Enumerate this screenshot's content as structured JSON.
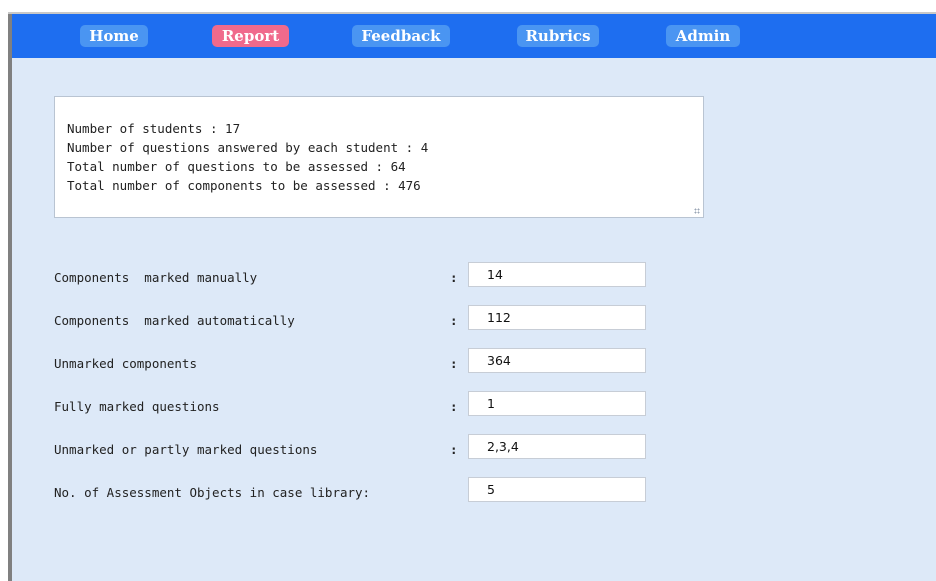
{
  "nav": {
    "items": [
      {
        "label": "Home",
        "active": false
      },
      {
        "label": "Report",
        "active": true
      },
      {
        "label": "Feedback",
        "active": false
      },
      {
        "label": "Rubrics",
        "active": false
      },
      {
        "label": "Admin",
        "active": false
      }
    ],
    "colors": {
      "bar": "#1e6ef0",
      "button": "#4a95f2",
      "active_button": "#f06a8c"
    }
  },
  "summary": {
    "lines": [
      "Number of students : 17",
      "Number of questions answered by each student : 4",
      "Total number of questions to be assessed : 64",
      "Total number of components to be assessed : 476"
    ]
  },
  "stats": {
    "separator": ":",
    "rows": [
      {
        "label": "Components  marked manually",
        "value": "14"
      },
      {
        "label": "Components  marked automatically",
        "value": "112"
      },
      {
        "label": "Unmarked components",
        "value": "364"
      },
      {
        "label": "Fully marked questions",
        "value": "1"
      },
      {
        "label": "Unmarked or partly marked questions",
        "value": "2,3,4"
      },
      {
        "label": "No. of Assessment Objects in case library:",
        "value": "5"
      }
    ]
  }
}
